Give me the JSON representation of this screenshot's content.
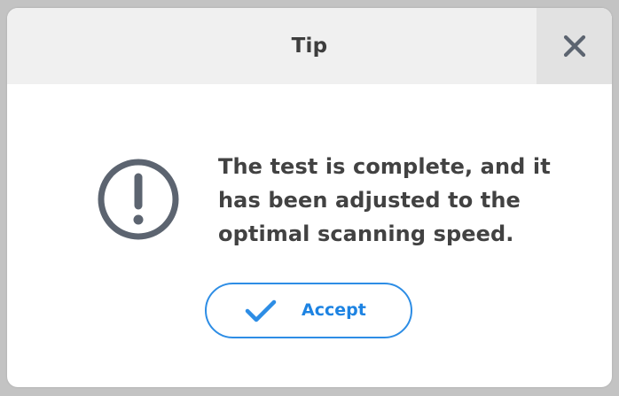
{
  "dialog": {
    "title": "Tip",
    "close_icon": "close-icon",
    "alert_icon": "exclamation-circle-icon",
    "message_lines": [
      "The test is complete, and it",
      "has been adjusted to the",
      "optimal scanning speed."
    ],
    "accept_button": {
      "label": "Accept",
      "icon": "checkmark-icon"
    }
  },
  "colors": {
    "backdrop": "#c3c3c3",
    "titlebar": "#f0f0f0",
    "close_button_bg": "#e2e2e2",
    "icon_gray": "#5c6470",
    "text_dark": "#424242",
    "accent_blue": "#2d8de5"
  }
}
